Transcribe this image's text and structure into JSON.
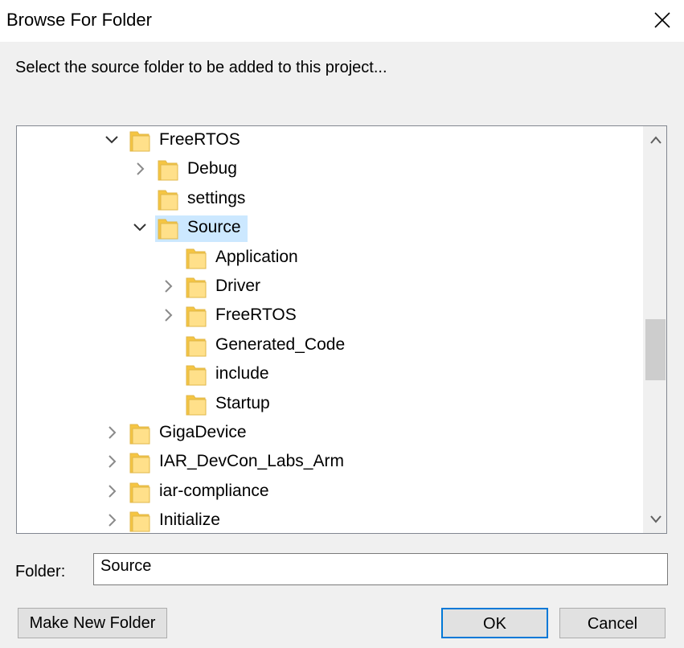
{
  "window": {
    "title": "Browse For Folder"
  },
  "prompt": "Select the source folder to be added to this project...",
  "tree": {
    "items": [
      {
        "label": "FreeRTOS",
        "level": 0,
        "expander": "expanded"
      },
      {
        "label": "Debug",
        "level": 1,
        "expander": "collapsed"
      },
      {
        "label": "settings",
        "level": 1,
        "expander": "none"
      },
      {
        "label": "Source",
        "level": 1,
        "expander": "expanded",
        "selected": true
      },
      {
        "label": "Application",
        "level": 2,
        "expander": "none"
      },
      {
        "label": "Driver",
        "level": 2,
        "expander": "collapsed"
      },
      {
        "label": "FreeRTOS",
        "level": 2,
        "expander": "collapsed"
      },
      {
        "label": "Generated_Code",
        "level": 2,
        "expander": "none"
      },
      {
        "label": "include",
        "level": 2,
        "expander": "none"
      },
      {
        "label": "Startup",
        "level": 2,
        "expander": "none"
      },
      {
        "label": "GigaDevice",
        "level": 0,
        "expander": "collapsed"
      },
      {
        "label": "IAR_DevCon_Labs_Arm",
        "level": 0,
        "expander": "collapsed"
      },
      {
        "label": "iar-compliance",
        "level": 0,
        "expander": "collapsed"
      },
      {
        "label": "Initialize",
        "level": 0,
        "expander": "collapsed"
      }
    ]
  },
  "folder": {
    "label": "Folder:",
    "value": "Source"
  },
  "buttons": {
    "make_new_folder": "Make New Folder",
    "ok": "OK",
    "cancel": "Cancel"
  },
  "colors": {
    "folder_fill": "#ffe08a",
    "folder_stroke": "#e0b74a",
    "selection": "#cce8ff",
    "focus_border": "#0078d7"
  }
}
